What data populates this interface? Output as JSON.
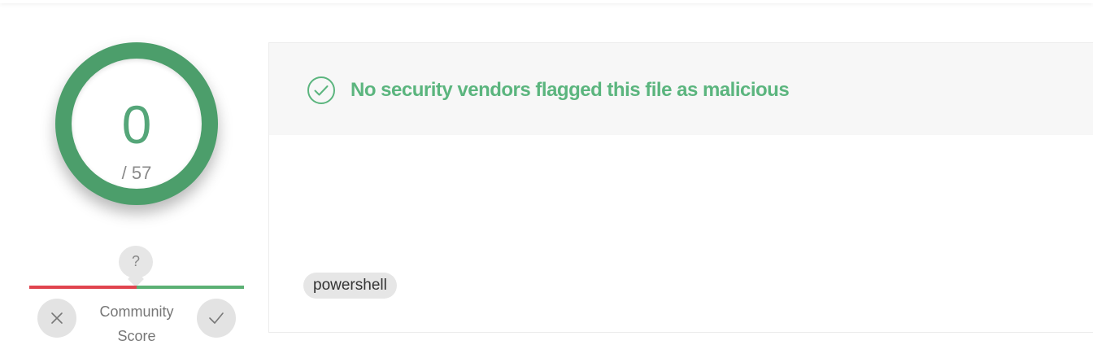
{
  "detection": {
    "score": "0",
    "total": "/ 57",
    "ring_color": "#4c9e6b"
  },
  "community_score": {
    "badge": "?",
    "label_line1": "Community",
    "label_line2": "Score",
    "vote_down_icon": "x-icon",
    "vote_up_icon": "check-icon",
    "negative_color": "#e0444e",
    "positive_color": "#5bb074"
  },
  "verdict": {
    "icon": "check-circle-icon",
    "text": "No security vendors flagged this file as malicious",
    "color": "#5bb57e"
  },
  "tags": [
    "powershell"
  ]
}
